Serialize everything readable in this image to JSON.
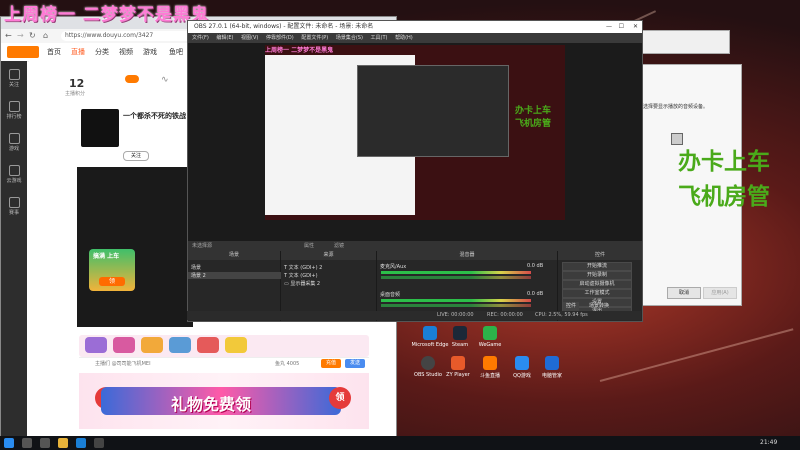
{
  "overlay": {
    "title": "上周榜一 二梦梦不是黑鬼"
  },
  "browser": {
    "url": "https://www.douyu.com/3427",
    "nav": [
      "首页",
      "直播",
      "分类",
      "视频",
      "游戏",
      "鱼吧"
    ],
    "rail": [
      "关注",
      "排行榜",
      "游戏",
      "云游戏",
      "赛事"
    ],
    "stats": {
      "count": "12",
      "label": "主播积分"
    },
    "streamer_title": "一个都杀不死的铁战",
    "follow_label": "关注",
    "viewers": "鱼丸 4005",
    "recharge_label": "充值",
    "send_label": "发送",
    "chat_placeholder": "主播们 @司司能飞机MEI",
    "banner_text": "礼物免费领",
    "banner_badge": "领",
    "promo_text": "搞满 上车",
    "promo_button": "领"
  },
  "obs": {
    "title": "OBS 27.0.1 (64-bit, windows) - 配置文件: 未命名 - 场景: 未命名",
    "menu": [
      "文件(F)",
      "编辑(E)",
      "视图(V)",
      "停靠部件(D)",
      "配置文件(P)",
      "场景集合(S)",
      "工具(T)",
      "帮助(H)"
    ],
    "preview_overlay_title": "上周榜一 二梦梦不是黑鬼",
    "green_ad": [
      "办卡上车",
      "飞机房管"
    ],
    "status_strip": {
      "left": "未选择源",
      "props": "属性",
      "filters": "滤镜"
    },
    "docks": {
      "scenes": {
        "title": "场景",
        "items": [
          "场景",
          "场景 2"
        ]
      },
      "sources": {
        "title": "来源",
        "items": [
          "文本 (GDI+) 2",
          "文本 (GDI+)",
          "显示器采集 2"
        ]
      },
      "mixer": {
        "title": "混音器",
        "tracks": [
          {
            "name": "麦克风/Aux",
            "db": "0.0 dB"
          },
          {
            "name": "桌面音频",
            "db": "0.0 dB"
          }
        ]
      },
      "controls": {
        "title": "控件",
        "buttons": [
          "开始推流",
          "开始录制",
          "启动虚拟摄像机",
          "工作室模式",
          "设置",
          "退出"
        ],
        "tabs": [
          "控件",
          "场景转换"
        ]
      }
    },
    "bottom_status": {
      "live": "LIVE: 00:00:00",
      "rec": "REC: 00:00:00",
      "cpu": "CPU: 2.5%, 59.94 fps"
    }
  },
  "dialog": {
    "text": "选择要显示播放的音频设备。",
    "cancel": "取消",
    "apply": "应用(A)"
  },
  "desktop_icons": [
    {
      "label": "Microsoft Edge",
      "color": "#1a7fd6"
    },
    {
      "label": "Steam",
      "color": "#1b2838"
    },
    {
      "label": "WeGame",
      "color": "#2db34a"
    },
    {
      "label": "OBS Studio",
      "color": "#444"
    },
    {
      "label": "ZY Player",
      "color": "#e85a2a"
    },
    {
      "label": "斗鱼直播",
      "color": "#ff7a00"
    },
    {
      "label": "QQ游戏",
      "color": "#2a8cf0"
    },
    {
      "label": "电脑管家",
      "color": "#1f6bd6"
    }
  ],
  "taskbar": {
    "time": "21:49"
  }
}
